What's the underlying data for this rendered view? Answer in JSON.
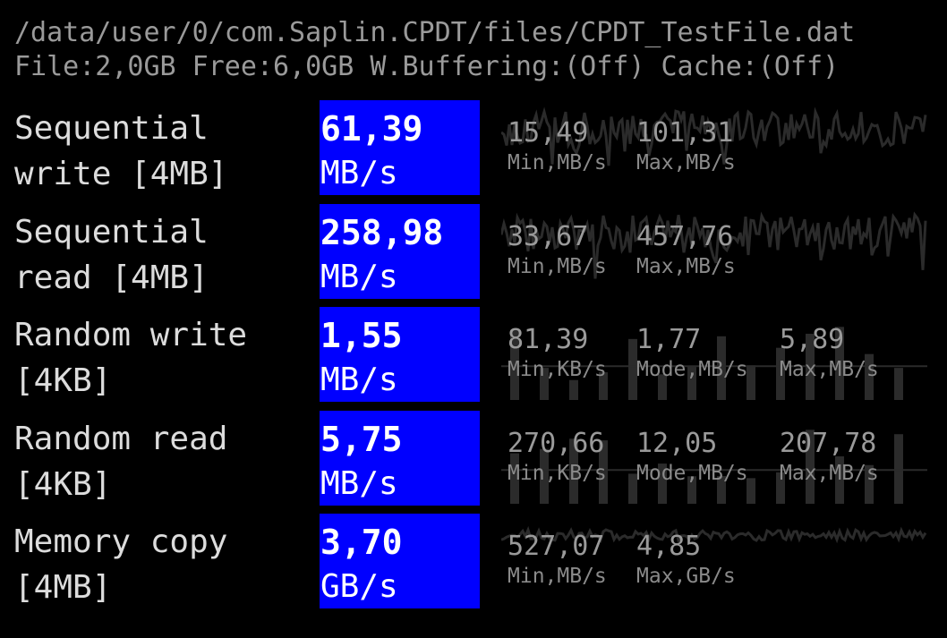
{
  "header": {
    "path": "/data/user/0/com.Saplin.CPDT/files/CPDT_TestFile.dat",
    "info": "File:2,0GB Free:6,0GB W.Buffering:(Off) Cache:(Off)"
  },
  "colors": {
    "accent_box": "#0000ff",
    "background": "#000000",
    "graph": "#2b2b2b"
  },
  "tests": [
    {
      "name": "Sequential\nwrite [4MB]",
      "value": "61,39",
      "unit": "MB/s",
      "stats": [
        {
          "value": "15,49",
          "caption": "Min,MB/s"
        },
        {
          "value": "101,31",
          "caption": "Max,MB/s"
        }
      ]
    },
    {
      "name": "Sequential\nread [4MB]",
      "value": "258,98",
      "unit": "MB/s",
      "stats": [
        {
          "value": "33,67",
          "caption": "Min,MB/s"
        },
        {
          "value": "457,76",
          "caption": "Max,MB/s"
        }
      ]
    },
    {
      "name": "Random write\n[4KB]",
      "value": "1,55",
      "unit": "MB/s",
      "stats": [
        {
          "value": "81,39",
          "caption": "Min,KB/s"
        },
        {
          "value": "1,77",
          "caption": "Mode,MB/s"
        },
        {
          "value": "5,89",
          "caption": "Max,MB/s"
        }
      ]
    },
    {
      "name": "Random read\n[4KB]",
      "value": "5,75",
      "unit": "MB/s",
      "stats": [
        {
          "value": "270,66",
          "caption": "Min,KB/s"
        },
        {
          "value": "12,05",
          "caption": "Mode,MB/s"
        },
        {
          "value": "207,78",
          "caption": "Max,MB/s"
        }
      ]
    },
    {
      "name": "Memory copy\n[4MB]",
      "value": "3,70",
      "unit": "GB/s",
      "stats": [
        {
          "value": "527,07",
          "caption": "Min,MB/s"
        },
        {
          "value": "4,85",
          "caption": "Max,GB/s"
        }
      ]
    }
  ]
}
